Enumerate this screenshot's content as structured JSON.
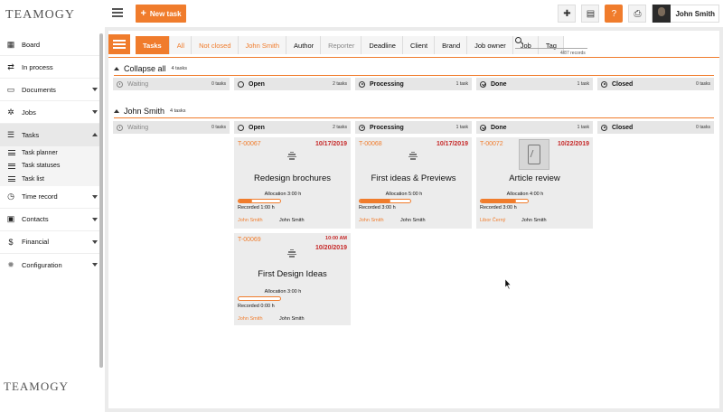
{
  "app": {
    "logo": "TEAMOGY",
    "new_task_label": "New task",
    "user_name": "John Smith"
  },
  "sidebar": {
    "items": [
      {
        "label": "Board",
        "icon": "grid-icon"
      },
      {
        "label": "In process",
        "icon": "flow-icon"
      },
      {
        "label": "Documents",
        "icon": "document-icon"
      },
      {
        "label": "Jobs",
        "icon": "gears-icon"
      },
      {
        "label": "Tasks",
        "icon": "tasks-icon"
      },
      {
        "label": "Time record",
        "icon": "clock-icon"
      },
      {
        "label": "Contacts",
        "icon": "contacts-icon"
      },
      {
        "label": "Financial",
        "icon": "dollar-icon"
      },
      {
        "label": "Configuration",
        "icon": "gear-icon"
      }
    ],
    "sub_items": [
      "Task planner",
      "Task statuses",
      "Task list"
    ]
  },
  "filters": {
    "crumbs": [
      "Tasks",
      "All",
      "Not closed",
      "John Smith",
      "Author",
      "Reporter",
      "Deadline",
      "Client",
      "Brand",
      "Job owner",
      "Job",
      "Tag"
    ],
    "records": "4/87 records"
  },
  "groups": {
    "collapse": {
      "title": "Collapse all",
      "count": "4 tasks"
    },
    "user": {
      "title": "John Smith",
      "count": "4 tasks"
    }
  },
  "statuses": [
    {
      "label": "Waiting",
      "count": "0 tasks"
    },
    {
      "label": "Open",
      "count": "2 tasks"
    },
    {
      "label": "Processing",
      "count": "1 task"
    },
    {
      "label": "Done",
      "count": "1 task"
    },
    {
      "label": "Closed",
      "count": "0 tasks"
    }
  ],
  "cards": [
    {
      "id": "T-00067",
      "date": "10/17/2019",
      "title": "Redesign brochures",
      "allocation": "Allocation 3:00 h",
      "allocation_progress": 0.33,
      "recorded": "Recorded 1:00 h",
      "owner": "John Smith",
      "assignee": "John Smith"
    },
    {
      "id": "T-00068",
      "date": "10/17/2019",
      "title": "First ideas & Previews",
      "allocation": "Allocation 5:00 h",
      "allocation_progress": 0.6,
      "recorded": "Recorded 3:00 h",
      "owner": "John Smith",
      "assignee": "John Smith"
    },
    {
      "id": "T-00072",
      "date": "10/22/2019",
      "title": "Article review",
      "allocation": "Allocation 4:00 h",
      "allocation_progress": 0.75,
      "recorded": "Recorded 3:00 h",
      "owner": "Libor Černý",
      "assignee": "John Smith"
    },
    {
      "id": "T-00069",
      "time": "10:00 AM",
      "date": "10/20/2019",
      "title": "First Design Ideas",
      "allocation": "Allocation 3:00 h",
      "allocation_progress": 0.0,
      "recorded": "Recorded 0:00 h",
      "owner": "John Smith",
      "assignee": "John Smith"
    }
  ],
  "colors": {
    "accent": "#f07c2c",
    "deadline": "#c62828"
  }
}
